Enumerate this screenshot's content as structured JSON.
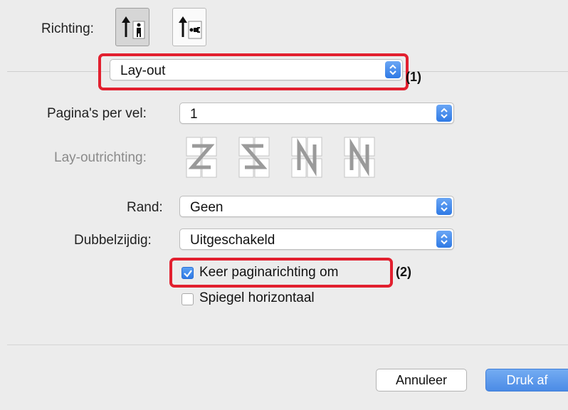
{
  "orientation": {
    "label": "Richting:",
    "options": [
      {
        "name": "portrait",
        "selected": true
      },
      {
        "name": "landscape",
        "selected": false
      }
    ]
  },
  "section_popup": {
    "value": "Lay-out"
  },
  "callouts": {
    "one": "(1)",
    "two": "(2)"
  },
  "pages_per_sheet": {
    "label": "Pagina's per vel:",
    "value": "1"
  },
  "layout_direction": {
    "label": "Lay-outrichting:",
    "icons": [
      "z-order-icon",
      "reverse-s-order-icon",
      "reverse-n-order-icon",
      "n-order-icon"
    ]
  },
  "border": {
    "label": "Rand:",
    "value": "Geen"
  },
  "two_sided": {
    "label": "Dubbelzijdig:",
    "value": "Uitgeschakeld"
  },
  "reverse_orientation": {
    "label": "Keer paginarichting om",
    "checked": true
  },
  "flip_horizontal": {
    "label": "Spiegel horizontaal",
    "checked": false
  },
  "buttons": {
    "cancel": "Annuleer",
    "print": "Druk af"
  },
  "colors": {
    "accent": "#2f7ae5",
    "highlight": "#e2202f"
  }
}
